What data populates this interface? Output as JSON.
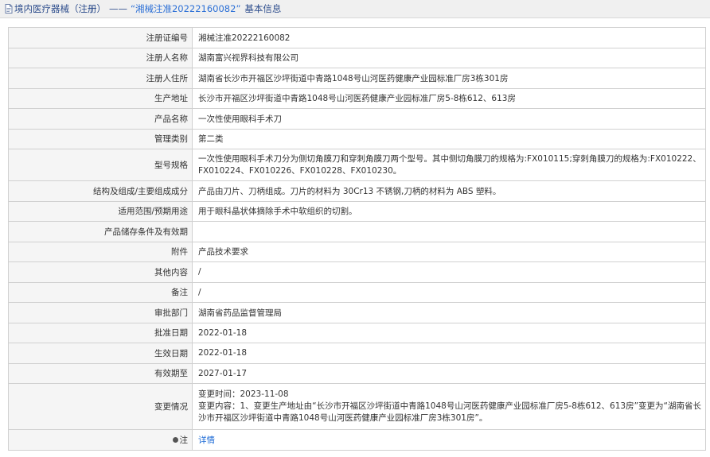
{
  "header": {
    "category": "境内医疗器械（注册）",
    "separator": "——",
    "reg_quoted": "“湘械注准20222160082”",
    "suffix": "基本信息"
  },
  "rows": [
    {
      "label": "注册证编号",
      "value": "湘械注准20222160082"
    },
    {
      "label": "注册人名称",
      "value": "湖南富兴视界科技有限公司"
    },
    {
      "label": "注册人住所",
      "value": "湖南省长沙市开福区沙坪街道中青路1048号山河医药健康产业园标准厂房3栋301房"
    },
    {
      "label": "生产地址",
      "value": "长沙市开福区沙坪街道中青路1048号山河医药健康产业园标准厂房5-8栋612、613房"
    },
    {
      "label": "产品名称",
      "value": "一次性使用眼科手术刀"
    },
    {
      "label": "管理类别",
      "value": "第二类"
    },
    {
      "label": "型号规格",
      "value": "一次性使用眼科手术刀分为侧切角膜刀和穿刺角膜刀两个型号。其中侧切角膜刀的规格为:FX010115;穿刺角膜刀的规格为:FX010222、FX010224、FX010226、FX010228、FX010230。"
    },
    {
      "label": "结构及组成/主要组成成分",
      "value": "产品由刀片、刀柄组成。刀片的材料为 30Cr13 不锈钢,刀柄的材料为 ABS 塑料。"
    },
    {
      "label": "适用范围/预期用途",
      "value": "用于眼科晶状体摘除手术中软组织的切割。"
    },
    {
      "label": "产品储存条件及有效期",
      "value": ""
    },
    {
      "label": "附件",
      "value": "产品技术要求"
    },
    {
      "label": "其他内容",
      "value": "/"
    },
    {
      "label": "备注",
      "value": "/"
    },
    {
      "label": "审批部门",
      "value": "湖南省药品监督管理局"
    },
    {
      "label": "批准日期",
      "value": "2022-01-18"
    },
    {
      "label": "生效日期",
      "value": "2022-01-18"
    },
    {
      "label": "有效期至",
      "value": "2027-01-17"
    }
  ],
  "change": {
    "label": "变更情况",
    "time_line": "变更时间：2023-11-08",
    "content_line": "变更内容：1、变更生产地址由“长沙市开福区沙坪街道中青路1048号山河医药健康产业园标准厂房5-8栋612、613房”变更为“湖南省长沙市开福区沙坪街道中青路1048号山河医药健康产业园标准厂房3栋301房”。"
  },
  "note": {
    "label": "注",
    "link_text": "详情"
  },
  "icons": {
    "header": "document-icon",
    "note": "pin-icon"
  },
  "colors": {
    "header_text": "#2b4b8b",
    "link": "#1e6bd6"
  }
}
